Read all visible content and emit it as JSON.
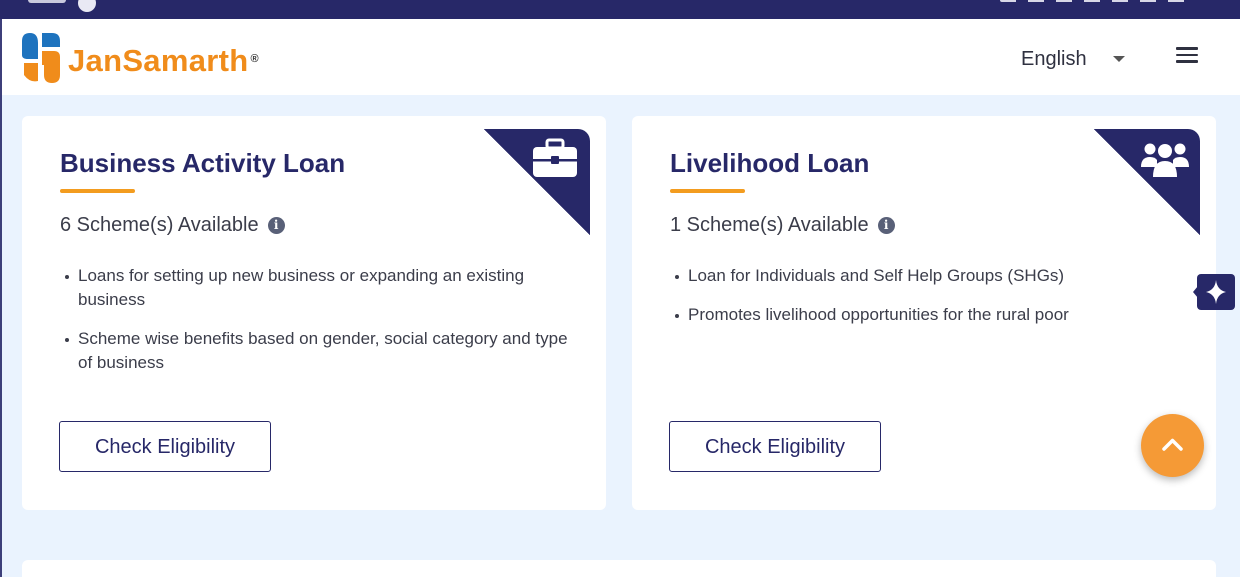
{
  "brand": {
    "name": "JanSamarth",
    "registered": "®",
    "colors": {
      "navy": "#272868",
      "orange": "#f08c1b",
      "blue": "#1e73be"
    }
  },
  "header": {
    "language": {
      "selected": "English"
    },
    "menu_icon": "hamburger-icon"
  },
  "cards": [
    {
      "title": "Business Activity Loan",
      "schemes": "6 Scheme(s) Available",
      "corner_icon": "briefcase-icon",
      "bullets": [
        "Loans for setting up new business or expanding an existing business",
        "Scheme wise benefits based on gender, social category and type of business"
      ],
      "button": "Check Eligibility"
    },
    {
      "title": "Livelihood Loan",
      "schemes": "1 Scheme(s) Available",
      "corner_icon": "group-icon",
      "bullets": [
        "Loan for Individuals and Self Help Groups (SHGs)",
        "Promotes livelihood opportunities for the rural poor"
      ],
      "button": "Check Eligibility"
    }
  ],
  "info_icon_glyph": "i",
  "floating": {
    "assistant_icon": "sparkle-icon",
    "scroll_top_icon": "chevron-up-icon",
    "accent": "#f59a36"
  }
}
